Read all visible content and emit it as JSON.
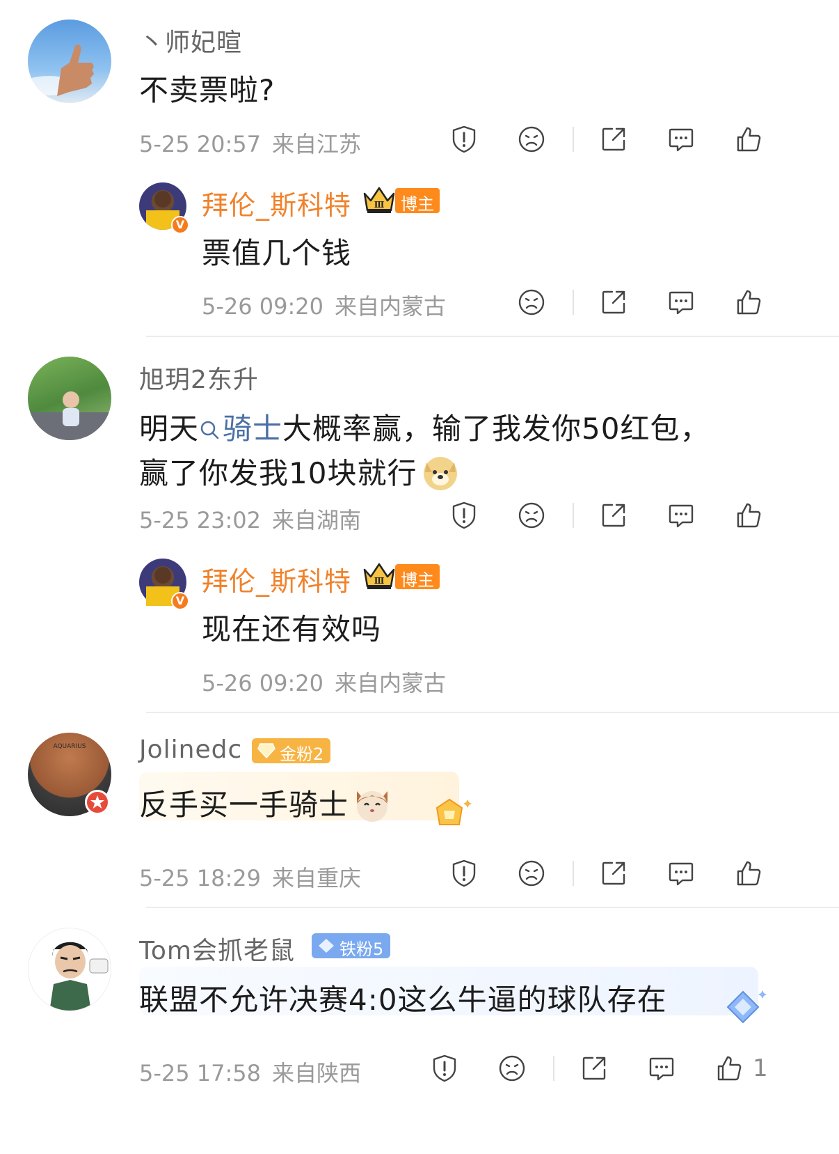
{
  "colors": {
    "blogger_name": "#f0822b",
    "blogger_badge": "#ff8a1c",
    "gold_badge": "#f8b443",
    "iron_badge": "#7aa9f0",
    "topic_link": "#4a6fa5",
    "meta_text": "#9a9a9a"
  },
  "comments": [
    {
      "username": "丶师妃暄",
      "text": "不卖票啦?",
      "time": "5-25 20:57",
      "location": "来自江苏",
      "reply": {
        "username": "拜伦_斯科特",
        "badge": "博主",
        "text": "票值几个钱",
        "time": "5-26 09:20",
        "location": "来自内蒙古"
      }
    },
    {
      "username": "旭玥2东升",
      "text_part1": "明天",
      "topic": "骑士",
      "text_part2": "大概率赢，输了我发你50红包，",
      "text_line2": "赢了你发我10块就行",
      "emoji": "doge-emoji",
      "time": "5-25 23:02",
      "location": "来自湖南",
      "reply": {
        "username": "拜伦_斯科特",
        "badge": "博主",
        "text": "现在还有效吗",
        "time": "5-26 09:20",
        "location": "来自内蒙古"
      }
    },
    {
      "username": "Jolinedc",
      "fan_badge": "金粉2",
      "text": "反手买一手骑士",
      "emoji": "cat-emoji",
      "time": "5-25 18:29",
      "location": "来自重庆"
    },
    {
      "username": "Tom会抓老鼠",
      "fan_badge": "铁粉5",
      "text": "联盟不允许决赛4:0这么牛逼的球队存在",
      "time": "5-25 17:58",
      "location": "来自陕西",
      "like_count": "1"
    }
  ]
}
